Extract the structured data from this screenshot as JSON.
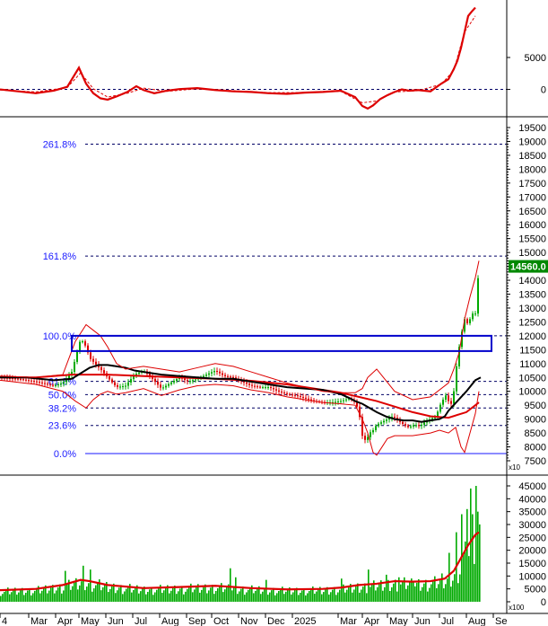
{
  "chart_data": [
    {
      "type": "line",
      "panel": "momentum",
      "ylim": [
        -4000,
        14000
      ],
      "y_ticks": [
        0,
        5000
      ],
      "zero_line": true,
      "colors": {
        "main": "#dd0000",
        "signal": "#dd0000"
      },
      "series": [
        {
          "x": [
            0,
            20,
            40,
            60,
            75,
            88,
            96,
            104,
            112,
            120,
            130,
            142,
            152,
            160,
            172,
            186,
            200,
            220,
            240,
            260,
            280,
            300,
            320,
            340,
            360,
            380,
            396,
            404,
            410,
            416,
            424,
            432,
            440,
            448,
            456,
            466,
            480,
            492,
            500,
            506,
            510,
            514,
            518,
            522,
            526,
            530
          ],
          "values": [
            0,
            -300,
            -600,
            -200,
            400,
            3400,
            900,
            -600,
            -1400,
            -1600,
            -1100,
            -400,
            500,
            -100,
            -600,
            -200,
            50,
            200,
            -100,
            -300,
            -400,
            -600,
            -700,
            -500,
            -400,
            -200,
            -1200,
            -2600,
            -3000,
            -2500,
            -1500,
            -900,
            -400,
            0,
            -200,
            -100,
            -300,
            900,
            1600,
            3200,
            4500,
            6500,
            9000,
            11500,
            12200,
            12800
          ]
        },
        {
          "x": [
            0,
            40,
            75,
            90,
            104,
            120,
            142,
            160,
            186,
            220,
            260,
            300,
            340,
            380,
            404,
            420,
            440,
            466,
            492,
            506,
            518,
            530
          ],
          "values": [
            -100,
            -400,
            300,
            2600,
            100,
            -1200,
            -600,
            200,
            -300,
            100,
            -200,
            -500,
            -500,
            -300,
            -2100,
            -1800,
            -400,
            -200,
            800,
            3000,
            9000,
            11500
          ]
        }
      ]
    },
    {
      "type": "line",
      "panel": "price",
      "ylim": [
        7500,
        19500
      ],
      "y_ticks": [
        7500,
        8000,
        8500,
        9000,
        9500,
        10000,
        10500,
        11000,
        11500,
        12000,
        12500,
        13000,
        13500,
        14000,
        14500,
        15000,
        15500,
        16000,
        16500,
        17000,
        17500,
        18000,
        18500,
        19000,
        19500
      ],
      "x_ticks": [
        "4",
        "Mar",
        "Apr",
        "May",
        "Jun",
        "Jul",
        "Aug",
        "Sep",
        "Oct",
        "Nov",
        "Dec",
        "2025",
        "Mar",
        "Apr",
        "May",
        "Jun",
        "Jul",
        "Aug",
        "Se"
      ],
      "last_price_label": "14560.0",
      "multiplier_label": "x10",
      "fibonacci": [
        {
          "label": "261.8%",
          "value": 18900
        },
        {
          "label": "161.8%",
          "value": 14870
        },
        {
          "label": "100.0%",
          "value": 12000
        },
        {
          "label": "61.8%",
          "value": 10360
        },
        {
          "label": "50.0%",
          "value": 9880
        },
        {
          "label": "38.2%",
          "value": 9400
        },
        {
          "label": "23.6%",
          "value": 8770
        },
        {
          "label": "0.0%",
          "value": 7760
        }
      ],
      "box": {
        "y_top": 12000,
        "y_bottom": 11450,
        "x_start": 80,
        "x_end": 548
      },
      "candles": {
        "up_color": "#00aa00",
        "down_color": "#dd0000"
      },
      "series": [
        {
          "name": "close",
          "color": "#e07070",
          "x": [
            0,
            20,
            40,
            60,
            70,
            80,
            90,
            96,
            100,
            106,
            112,
            120,
            130,
            140,
            150,
            160,
            170,
            180,
            190,
            200,
            210,
            220,
            230,
            240,
            250,
            260,
            270,
            280,
            290,
            300,
            310,
            320,
            330,
            340,
            350,
            360,
            370,
            380,
            390,
            396,
            400,
            404,
            408,
            412,
            416,
            420,
            426,
            432,
            438,
            444,
            450,
            456,
            462,
            468,
            474,
            480,
            486,
            492,
            498,
            502,
            506,
            510,
            514,
            518,
            522,
            526,
            530,
            534
          ],
          "values": [
            10500,
            10450,
            10350,
            10200,
            10300,
            10700,
            11900,
            11600,
            11200,
            11000,
            10800,
            10500,
            10150,
            10200,
            10600,
            10750,
            10450,
            10100,
            10300,
            10500,
            10350,
            10450,
            10600,
            10750,
            10550,
            10500,
            10350,
            10200,
            10150,
            10150,
            10000,
            9900,
            9850,
            9750,
            9650,
            9600,
            9600,
            9650,
            9750,
            9600,
            9300,
            8400,
            8200,
            8500,
            8600,
            8800,
            8900,
            9000,
            9100,
            8950,
            8800,
            8700,
            8800,
            8750,
            8900,
            9000,
            9100,
            9600,
            9900,
            9400,
            10000,
            11200,
            12000,
            12600,
            12400,
            12800,
            12800,
            14500
          ]
        },
        {
          "name": "ma-long",
          "color": "#dd0000",
          "x": [
            0,
            40,
            80,
            120,
            160,
            200,
            240,
            280,
            320,
            360,
            380,
            400,
            420,
            440,
            460,
            480,
            500,
            520,
            534
          ],
          "values": [
            10500,
            10500,
            10600,
            10600,
            10550,
            10500,
            10450,
            10380,
            10250,
            10050,
            9950,
            9800,
            9650,
            9450,
            9250,
            9100,
            9050,
            9250,
            9600
          ]
        },
        {
          "name": "ma-short",
          "color": "#000000",
          "x": [
            0,
            30,
            60,
            80,
            90,
            100,
            110,
            120,
            130,
            140,
            150,
            160,
            170,
            180,
            200,
            220,
            240,
            260,
            280,
            300,
            320,
            340,
            360,
            380,
            390,
            396,
            404,
            412,
            420,
            430,
            440,
            450,
            460,
            470,
            480,
            490,
            496,
            500,
            510,
            520,
            530,
            536
          ],
          "values": [
            10500,
            10500,
            10400,
            10450,
            10650,
            10850,
            10950,
            10950,
            10900,
            10850,
            10750,
            10700,
            10650,
            10600,
            10550,
            10500,
            10450,
            10450,
            10350,
            10250,
            10150,
            10100,
            10050,
            9900,
            9750,
            9650,
            9550,
            9400,
            9250,
            9100,
            9000,
            8950,
            8950,
            8900,
            8950,
            9000,
            9100,
            9300,
            9650,
            10000,
            10400,
            10500
          ]
        },
        {
          "name": "band-upper",
          "color": "#dd0000",
          "x": [
            0,
            40,
            70,
            84,
            96,
            104,
            112,
            120,
            130,
            140,
            160,
            180,
            200,
            220,
            240,
            260,
            280,
            300,
            320,
            340,
            360,
            380,
            396,
            404,
            410,
            420,
            430,
            440,
            460,
            480,
            500,
            506,
            512,
            518,
            524,
            530,
            534
          ],
          "values": [
            10550,
            10500,
            10600,
            11800,
            12400,
            12200,
            12000,
            11600,
            11000,
            10800,
            10900,
            10800,
            10700,
            10850,
            11000,
            10900,
            10700,
            10500,
            10300,
            10150,
            10000,
            9950,
            9950,
            10100,
            10500,
            10800,
            10400,
            10000,
            9700,
            9800,
            10300,
            10800,
            11400,
            12600,
            13400,
            14100,
            14700
          ]
        },
        {
          "name": "band-lower",
          "color": "#dd0000",
          "x": [
            0,
            40,
            70,
            84,
            96,
            104,
            112,
            120,
            130,
            140,
            160,
            180,
            200,
            220,
            240,
            260,
            280,
            300,
            320,
            340,
            360,
            380,
            396,
            404,
            410,
            416,
            420,
            426,
            432,
            440,
            460,
            480,
            490,
            500,
            508,
            514,
            518,
            524,
            530,
            534
          ],
          "values": [
            10400,
            10250,
            10000,
            9650,
            9400,
            9700,
            9900,
            10000,
            9900,
            9950,
            10100,
            9850,
            10050,
            10200,
            10250,
            10200,
            10050,
            9950,
            9800,
            9700,
            9600,
            9550,
            9500,
            9000,
            8500,
            7800,
            7700,
            8000,
            8300,
            8400,
            8400,
            8500,
            8600,
            8500,
            8700,
            8000,
            7800,
            8500,
            9200,
            10000
          ]
        }
      ]
    },
    {
      "type": "bar",
      "panel": "volume",
      "ylim": [
        0,
        45000
      ],
      "y_ticks": [
        0,
        5000,
        10000,
        15000,
        20000,
        25000,
        30000,
        35000,
        40000,
        45000
      ],
      "multiplier_label": "x100",
      "colors": {
        "bars": "#00aa00",
        "ma": "#dd0000"
      },
      "spikes": [
        {
          "x": 72,
          "value": 12000
        },
        {
          "x": 92,
          "value": 14000
        },
        {
          "x": 100,
          "value": 12500
        },
        {
          "x": 155,
          "value": 9000
        },
        {
          "x": 185,
          "value": 7500
        },
        {
          "x": 241,
          "value": 20000
        },
        {
          "x": 256,
          "value": 13000
        },
        {
          "x": 262,
          "value": 9500
        },
        {
          "x": 296,
          "value": 8500
        },
        {
          "x": 380,
          "value": 9000
        },
        {
          "x": 410,
          "value": 12500
        },
        {
          "x": 430,
          "value": 10500
        },
        {
          "x": 444,
          "value": 9500
        },
        {
          "x": 460,
          "value": 8000
        },
        {
          "x": 492,
          "value": 11000
        },
        {
          "x": 500,
          "value": 19000
        },
        {
          "x": 508,
          "value": 27000
        },
        {
          "x": 514,
          "value": 34000
        },
        {
          "x": 520,
          "value": 36000
        },
        {
          "x": 524,
          "value": 44000
        },
        {
          "x": 526,
          "value": 34000
        },
        {
          "x": 530,
          "value": 45000
        },
        {
          "x": 532,
          "value": 35000
        }
      ],
      "ma_line": {
        "x": [
          0,
          40,
          70,
          90,
          100,
          120,
          160,
          200,
          240,
          280,
          320,
          360,
          380,
          400,
          420,
          440,
          460,
          480,
          496,
          506,
          514,
          522,
          530,
          534
        ],
        "values": [
          4500,
          5000,
          6500,
          8500,
          8000,
          6500,
          5300,
          5700,
          6200,
          5300,
          4800,
          5000,
          5500,
          6500,
          7000,
          8000,
          7800,
          8000,
          9000,
          12000,
          17000,
          22000,
          26000,
          27000
        ]
      }
    }
  ]
}
